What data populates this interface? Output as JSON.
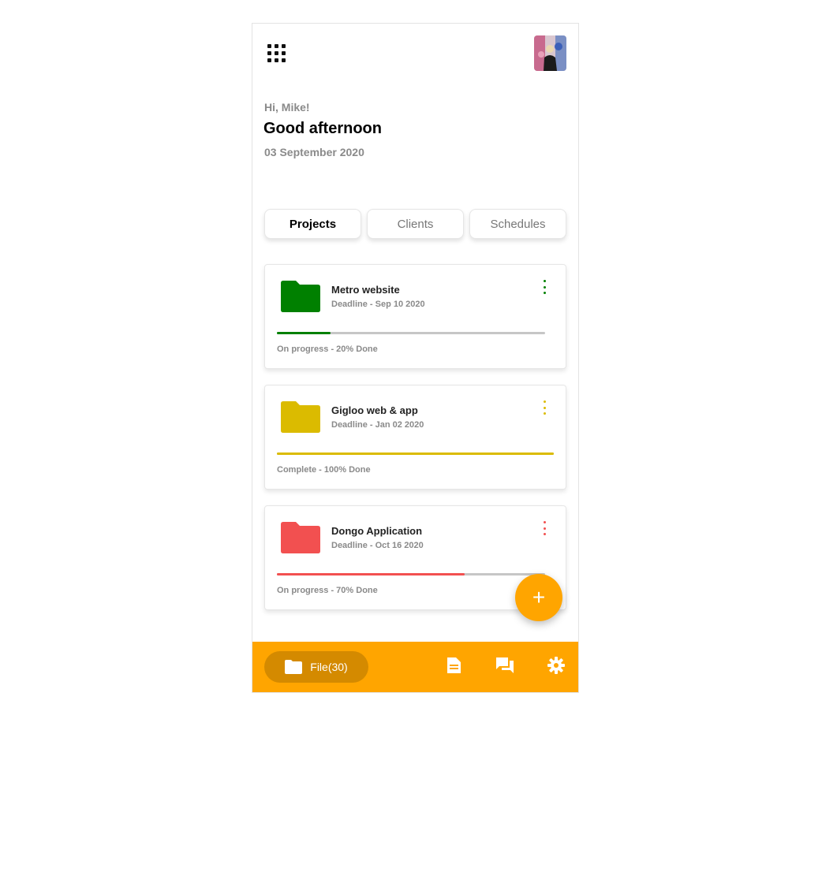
{
  "header": {
    "greeting": "Hi, Mike!",
    "headline": "Good afternoon",
    "date": "03 September 2020",
    "menu_icon": "grid-dots-icon",
    "avatar": "user-avatar"
  },
  "tabs": [
    {
      "label": "Projects",
      "active": true
    },
    {
      "label": "Clients",
      "active": false
    },
    {
      "label": "Schedules",
      "active": false
    }
  ],
  "projects": [
    {
      "title": "Metro website",
      "deadline": "Deadline - Sep 10 2020",
      "status": "On progress - 20% Done",
      "progress": 0.2,
      "color": "#008000"
    },
    {
      "title": "Gigloo web & app",
      "deadline": "Deadline - Jan 02 2020",
      "status": "Complete - 100% Done",
      "progress": 1.0,
      "color": "#dbbb00"
    },
    {
      "title": "Dongo Application",
      "deadline": "Deadline - Oct 16 2020",
      "status": "On progress - 70% Done",
      "progress": 0.7,
      "color": "#f25050"
    }
  ],
  "fab": {
    "label": "+"
  },
  "bottom_nav": {
    "file_label": "File(30)",
    "icons": [
      "folder-icon",
      "document-icon",
      "chat-icon",
      "settings-icon"
    ],
    "bar_color": "#ffa500"
  }
}
